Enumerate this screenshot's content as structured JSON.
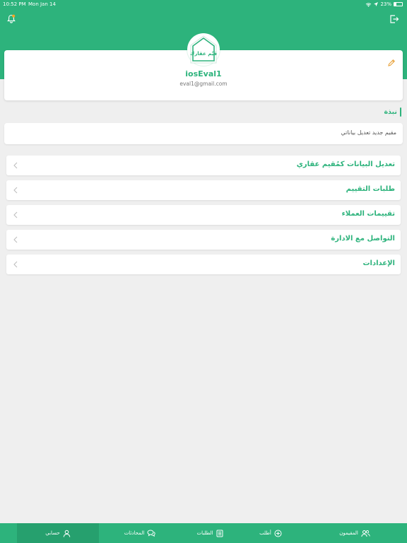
{
  "status_bar": {
    "time": "10:52 PM",
    "date": "Mon Jan 14",
    "battery": "23%"
  },
  "profile": {
    "name": "iosEval1",
    "email": "eval1@gmail.com",
    "logo_text": "قيّم عقارك"
  },
  "bio": {
    "title": "نبذة",
    "text": "مقيم جديد تعديل بياناتي"
  },
  "menu": [
    {
      "label": "تعديل البيانات كمُقيم عقاري"
    },
    {
      "label": "طلبات التقييم"
    },
    {
      "label": "تقييمات العملاء"
    },
    {
      "label": "التواصل مع الادارة"
    },
    {
      "label": "الإعدادات"
    }
  ],
  "tabs": [
    {
      "label": "حسابي",
      "icon": "person-icon",
      "active": true
    },
    {
      "label": "المحادثات",
      "icon": "chat-icon"
    },
    {
      "label": "الطلبات",
      "icon": "list-icon"
    },
    {
      "label": "أطلب",
      "icon": "plus-circle-icon"
    },
    {
      "label": "المقيمون",
      "icon": "users-icon"
    }
  ],
  "colors": {
    "primary": "#2db37c",
    "primary_dark": "#26a06e",
    "background": "#efefef"
  }
}
